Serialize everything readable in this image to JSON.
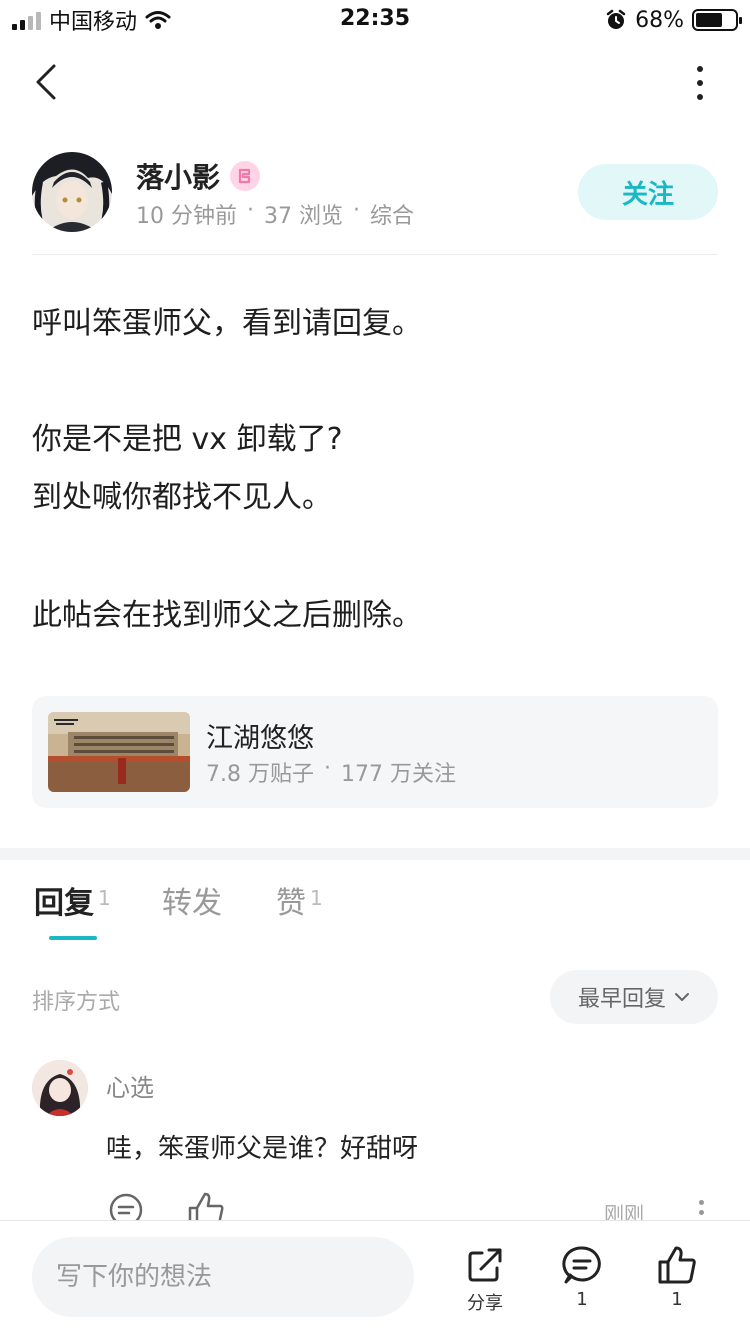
{
  "status_bar": {
    "carrier": "中国移动",
    "time": "22:35",
    "battery": "68%",
    "battery_level": 0.68
  },
  "author": {
    "name": "落小影",
    "time_ago": "10 分钟前",
    "views": "37 浏览",
    "category": "综合",
    "follow_label": "关注"
  },
  "post": {
    "lines": [
      "呼叫笨蛋师父，看到请回复。",
      "你是不是把 vx 卸载了?",
      "到处喊你都找不见人。",
      "此帖会在找到师父之后删除。"
    ]
  },
  "forum": {
    "name": "江湖悠悠",
    "posts": "7.8 万贴子",
    "followers": "177 万关注"
  },
  "tabs": [
    {
      "label": "回复",
      "count": "1"
    },
    {
      "label": "转发",
      "count": ""
    },
    {
      "label": "赞",
      "count": "1"
    }
  ],
  "sort": {
    "label": "排序方式",
    "value": "最早回复"
  },
  "comment": {
    "user": "心选",
    "text": "哇，笨蛋师父是谁？好甜呀",
    "time": "刚刚"
  },
  "bottom": {
    "placeholder": "写下你的想法",
    "share_label": "分享",
    "comment_count": "1",
    "like_count": "1"
  },
  "colors": {
    "accent": "#19b8c4",
    "follow_bg": "#e2f7f8"
  }
}
